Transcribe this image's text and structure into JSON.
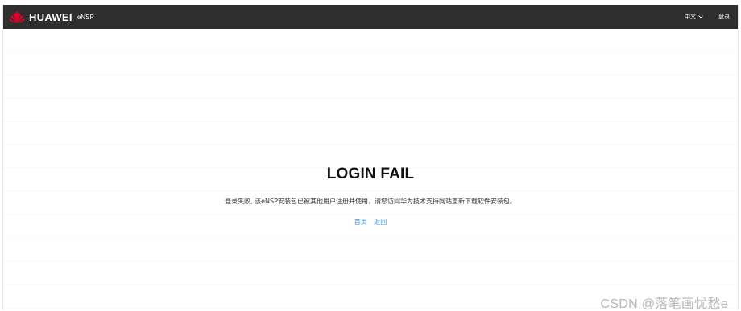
{
  "header": {
    "brand": "HUAWEI",
    "product": "eNSP",
    "language": "中文",
    "login_label": "登录",
    "background_color": "#2e2e2e",
    "logo_color": "#e4002b"
  },
  "main": {
    "title": "LOGIN FAIL",
    "message": "登录失败, 该eNSP安装包已被其他用户注册并使用，请您访问华为技术支持网站重新下载软件安装包。",
    "links": {
      "home": "首页",
      "back": "返回"
    },
    "link_color": "#3a8ee6"
  },
  "watermark": {
    "text": "CSDN @落笔画忧愁e"
  }
}
